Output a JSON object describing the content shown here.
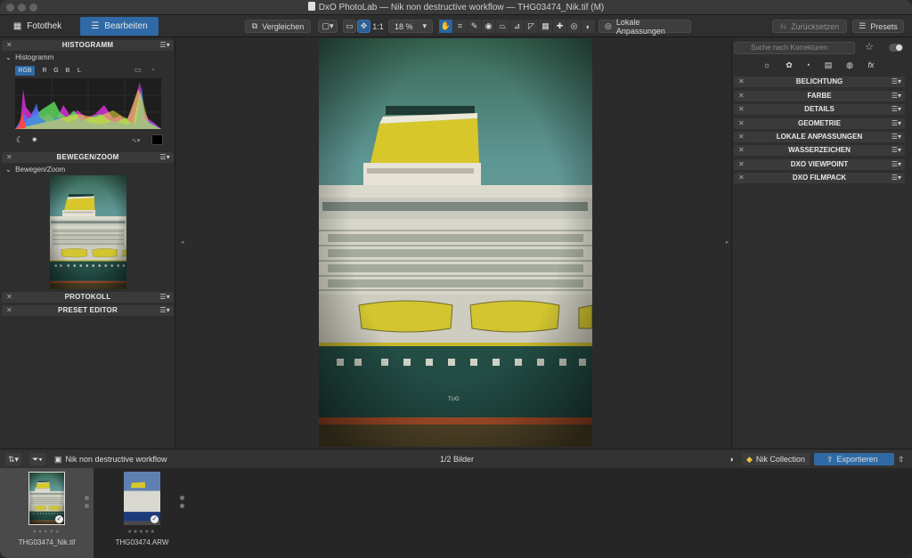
{
  "window": {
    "title": "DxO PhotoLab — Nik non destructive workflow — THG03474_Nik.tif (M)"
  },
  "toolbar": {
    "tab_library": "Fotothek",
    "tab_edit": "Bearbeiten",
    "compare": "Vergleichen",
    "zoom_one": "1:1",
    "zoom_value": "18 %",
    "local_adjust": "Lokale Anpassungen",
    "reset": "Zurücksetzen",
    "presets": "Presets"
  },
  "left": {
    "histogram_header": "HISTOGRAMM",
    "histogram_sub": "Histogramm",
    "channels": [
      "RGB",
      "R",
      "G",
      "B",
      "L"
    ],
    "movezoom_header": "BEWEGEN/ZOOM",
    "movezoom_sub": "Bewegen/Zoom",
    "history_header": "PROTOKOLL",
    "preset_editor_header": "PRESET EDITOR"
  },
  "right": {
    "search_placeholder": "Suche nach Korrekturen",
    "sections": [
      "BELICHTUNG",
      "FARBE",
      "DETAILS",
      "GEOMETRIE",
      "LOKALE ANPASSUNGEN",
      "WASSERZEICHEN",
      "DXO VIEWPOINT",
      "DXO FILMPACK"
    ],
    "fx_label": "fx"
  },
  "bottom": {
    "project": "Nik non destructive workflow",
    "count": "1/2 Bilder",
    "nik": "Nik Collection",
    "export": "Exportieren"
  },
  "filmstrip": [
    {
      "name": "THG03474_Nik.tif",
      "stars": "★★★★★"
    },
    {
      "name": "THG03474.ARW",
      "stars": "★★★★★"
    }
  ],
  "photo": {
    "hull_mark": "TUG"
  },
  "colors": {
    "accent": "#2f6aa6",
    "panel": "#2e2e2e",
    "header": "#3a3a3a"
  }
}
